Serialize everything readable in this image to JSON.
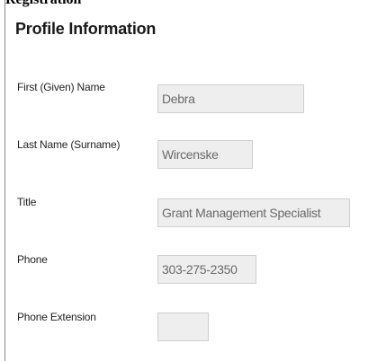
{
  "clipped_heading": "Registration",
  "section": {
    "title": "Profile Information"
  },
  "fields": {
    "first_name": {
      "label": "First (Given) Name",
      "value": "Debra"
    },
    "last_name": {
      "label": "Last Name (Surname)",
      "value": "Wircenske"
    },
    "title": {
      "label": "Title",
      "value": "Grant Management Specialist"
    },
    "phone": {
      "label": "Phone",
      "value": "303-275-2350"
    },
    "phone_extension": {
      "label": "Phone Extension",
      "value": ""
    }
  }
}
